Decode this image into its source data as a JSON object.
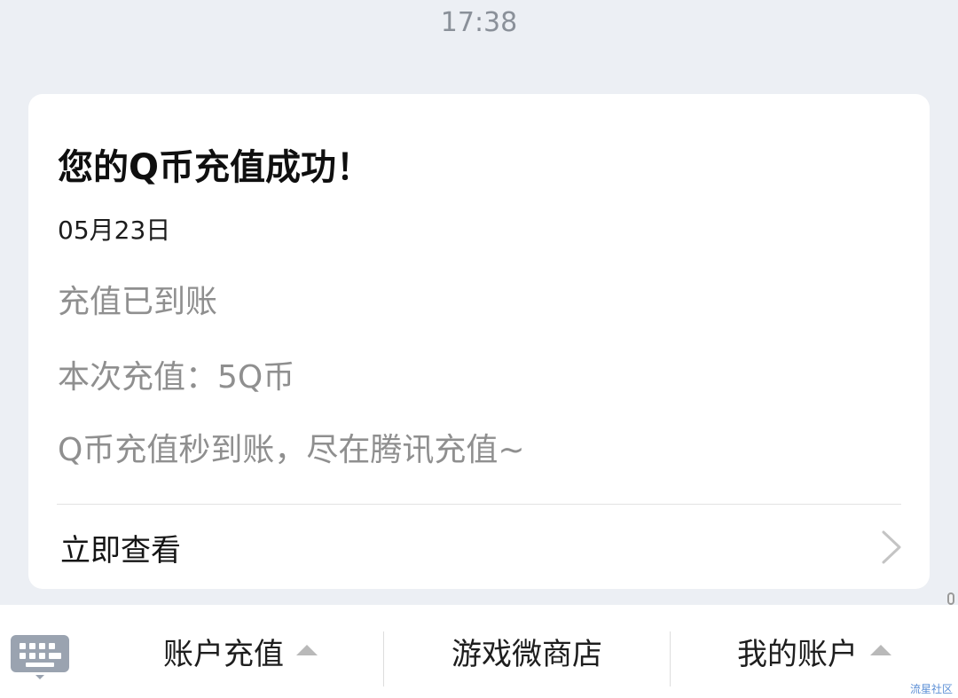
{
  "chat": {
    "timestamp": "17:38"
  },
  "card": {
    "title": "您的Q币充值成功！",
    "date": "05月23日",
    "lines": [
      "充值已到账",
      "本次充值：5Q币",
      "Q币充值秒到账，尽在腾讯充值~"
    ],
    "action_label": "立即查看",
    "action_icon": "chevron-right-icon"
  },
  "bottom_bar": {
    "keyboard_icon": "keyboard-icon",
    "tabs": [
      {
        "label": "账户充值",
        "has_submenu": true
      },
      {
        "label": "游戏微商店",
        "has_submenu": false
      },
      {
        "label": "我的账户",
        "has_submenu": true
      }
    ]
  },
  "watermark": "流星社区",
  "colors": {
    "background": "#eceff4",
    "card": "#ffffff",
    "muted_text": "#8f8f8f",
    "watermark": "#5c8fd6"
  }
}
